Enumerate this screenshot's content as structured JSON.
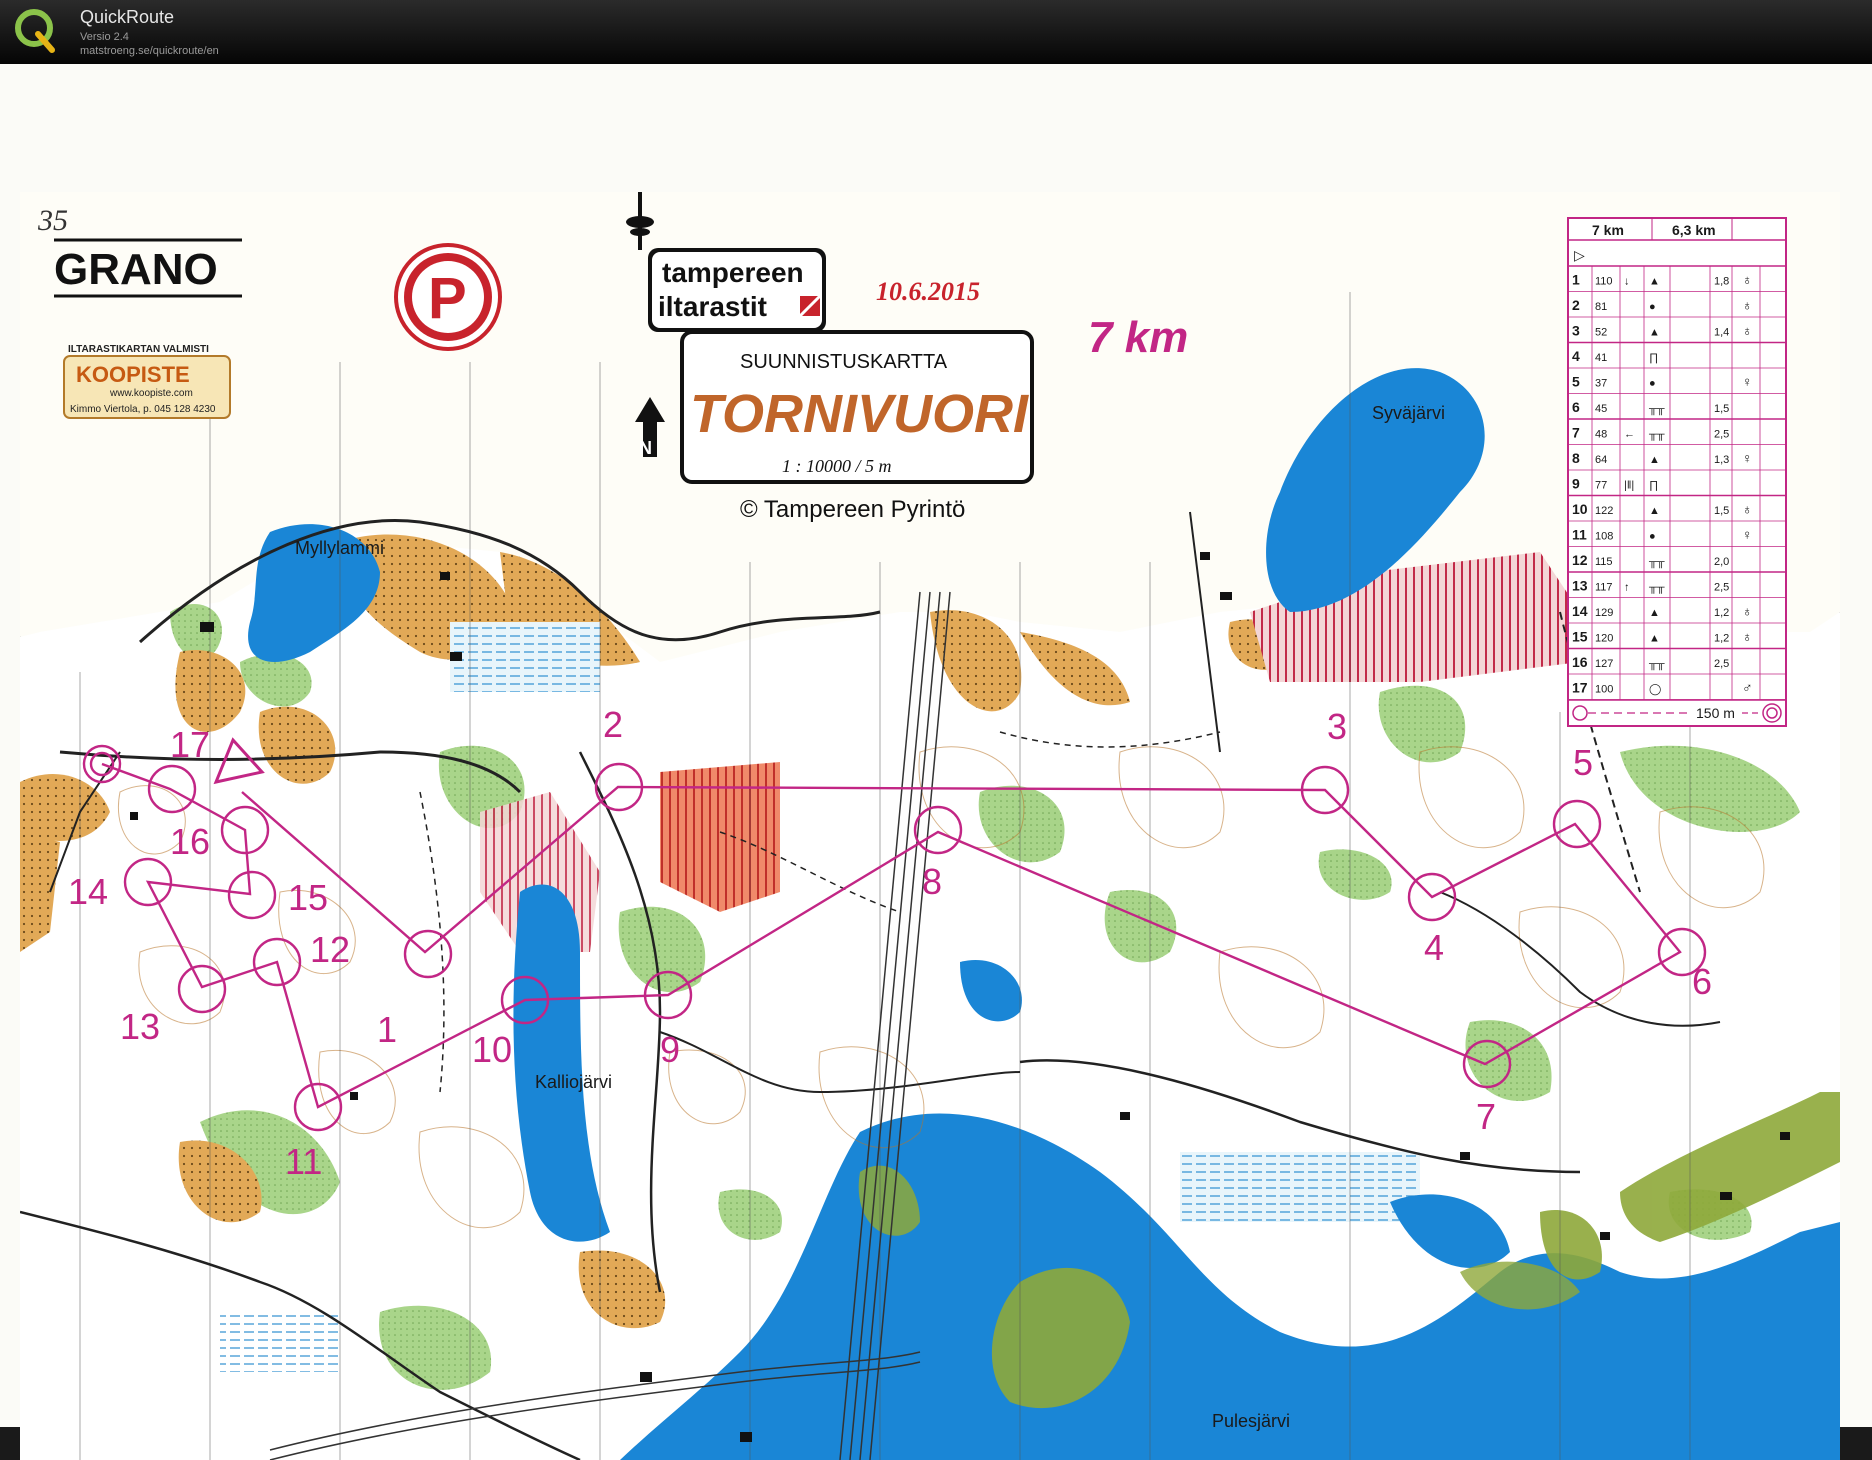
{
  "app": {
    "name": "QuickRoute",
    "version": "Versio 2.4",
    "url": "matstroeng.se/quickroute/en"
  },
  "map": {
    "handwritten_note": "35",
    "printer_logo": "GRANO",
    "maker_header": "ILTARASTIKARTAN VALMISTI",
    "maker_name": "KOOPISTE",
    "maker_web": "www.koopiste.com",
    "maker_contact": "Kimmo Viertola, p. 045 128 4230",
    "parking_symbol": "P",
    "brand_line1": "tampereen",
    "brand_line2": "iltarastit",
    "date": "10.6.2015",
    "map_type": "SUUNNISTUSKARTTA",
    "map_name": "TORNIVUORI",
    "scale": "1 : 10000 / 5 m",
    "copyright": "© Tampereen Pyrintö",
    "course_length": "7 km",
    "lakes": [
      "Myllylammi",
      "Syväjärvi",
      "Kalliojärvi",
      "Pulesjärvi"
    ],
    "colors": {
      "course": "#c22685",
      "water": "#1a86d6",
      "open_land": "#e2a957",
      "vegetation": "#8ec46a",
      "marsh": "#c9e8f0",
      "brand_red": "#c8232c"
    }
  },
  "course": {
    "controls": [
      {
        "n": "1",
        "label": "1"
      },
      {
        "n": "2",
        "label": "2"
      },
      {
        "n": "3",
        "label": "3"
      },
      {
        "n": "4",
        "label": "4"
      },
      {
        "n": "5",
        "label": "5"
      },
      {
        "n": "6",
        "label": "6"
      },
      {
        "n": "7",
        "label": "7"
      },
      {
        "n": "8",
        "label": "8"
      },
      {
        "n": "9",
        "label": "9"
      },
      {
        "n": "10",
        "label": "10"
      },
      {
        "n": "11",
        "label": "11"
      },
      {
        "n": "12",
        "label": "12"
      },
      {
        "n": "13",
        "label": "13"
      },
      {
        "n": "14",
        "label": "14"
      },
      {
        "n": "15",
        "label": "15"
      },
      {
        "n": "16",
        "label": "16"
      },
      {
        "n": "17",
        "label": "17"
      }
    ]
  },
  "description_sheet": {
    "header_left": "7 km",
    "header_right": "6,3 km",
    "start_symbol": "▷",
    "rows": [
      {
        "n": "1",
        "code": "110",
        "dir": "↓",
        "sym": "▲",
        "dim": "1,8",
        "extra": "♁"
      },
      {
        "n": "2",
        "code": "81",
        "dir": "",
        "sym": "●",
        "dim": "",
        "extra": "♁"
      },
      {
        "n": "3",
        "code": "52",
        "dir": "",
        "sym": "▲",
        "dim": "1,4",
        "extra": "♁"
      },
      {
        "n": "4",
        "code": "41",
        "dir": "",
        "sym": "∏",
        "dim": "",
        "extra": ""
      },
      {
        "n": "5",
        "code": "37",
        "dir": "",
        "sym": "●",
        "dim": "",
        "extra": "♀"
      },
      {
        "n": "6",
        "code": "45",
        "dir": "",
        "sym": "╥╥",
        "dim": "1,5",
        "extra": ""
      },
      {
        "n": "7",
        "code": "48",
        "dir": "←",
        "sym": "╥╥",
        "dim": "2,5",
        "extra": ""
      },
      {
        "n": "8",
        "code": "64",
        "dir": "",
        "sym": "▲",
        "dim": "1,3",
        "extra": "♀"
      },
      {
        "n": "9",
        "code": "77",
        "dir": "|‖|",
        "sym": "∏",
        "dim": "",
        "extra": ""
      },
      {
        "n": "10",
        "code": "122",
        "dir": "",
        "sym": "▲",
        "dim": "1,5",
        "extra": "♁"
      },
      {
        "n": "11",
        "code": "108",
        "dir": "",
        "sym": "●",
        "dim": "",
        "extra": "♀"
      },
      {
        "n": "12",
        "code": "115",
        "dir": "",
        "sym": "╥╥",
        "dim": "2,0",
        "extra": ""
      },
      {
        "n": "13",
        "code": "117",
        "dir": "↑",
        "sym": "╥╥",
        "dim": "2,5",
        "extra": ""
      },
      {
        "n": "14",
        "code": "129",
        "dir": "",
        "sym": "▲",
        "dim": "1,2",
        "extra": "♁"
      },
      {
        "n": "15",
        "code": "120",
        "dir": "",
        "sym": "▲",
        "dim": "1,2",
        "extra": "♁"
      },
      {
        "n": "16",
        "code": "127",
        "dir": "",
        "sym": "╥╥",
        "dim": "2,5",
        "extra": ""
      },
      {
        "n": "17",
        "code": "100",
        "dir": "",
        "sym": "◯",
        "dim": "",
        "extra": "♂"
      }
    ],
    "finish_distance": "150 m"
  }
}
